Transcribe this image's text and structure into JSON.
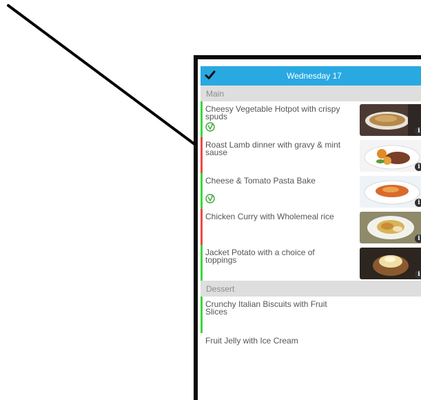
{
  "header": {
    "title": "Wednesday 17",
    "check_icon": "checkmark-icon",
    "color": "#29a9e1"
  },
  "colors": {
    "healthy": "#3ed63e",
    "treat": "#ee4747",
    "section_bg": "#dedede"
  },
  "sections": [
    {
      "title": "Main",
      "items": [
        {
          "name": "Cheesy Vegetable Hotpot with crispy spuds",
          "status": "green",
          "vegetarian": true,
          "image": "hotpot-photo"
        },
        {
          "name": "Roast Lamb dinner with gravy & mint sause",
          "status": "red",
          "vegetarian": false,
          "image": "roast-lamb-photo"
        },
        {
          "name": "Cheese & Tomato Pasta Bake",
          "status": "green",
          "vegetarian": true,
          "image": "pasta-bake-photo"
        },
        {
          "name": "Chicken Curry with Wholemeal rice",
          "status": "red",
          "vegetarian": false,
          "image": "chicken-curry-photo"
        },
        {
          "name": "Jacket Potato with a choice of toppings",
          "status": "green",
          "vegetarian": false,
          "image": "jacket-potato-photo"
        }
      ]
    },
    {
      "title": "Dessert",
      "items": [
        {
          "name": "Crunchy Italian Biscuits with Fruit Slices",
          "status": "green"
        },
        {
          "name": "Fruit Jelly with Ice Cream",
          "status": "none"
        }
      ]
    }
  ],
  "info_glyph": "i"
}
